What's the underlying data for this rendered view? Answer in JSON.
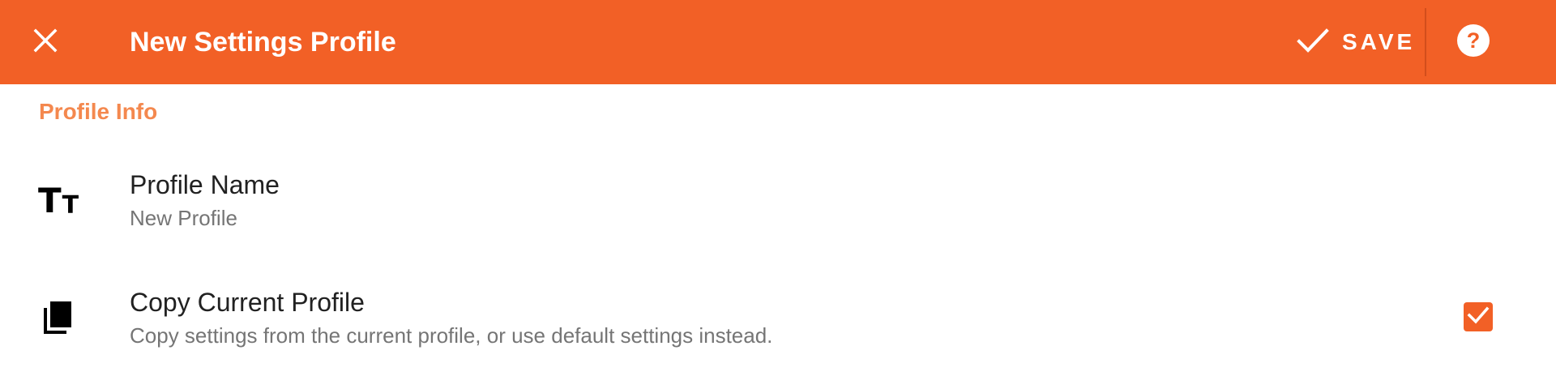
{
  "toolbar": {
    "title": "New Settings Profile",
    "close_icon": "close-icon",
    "save_label": "SAVE",
    "save_icon": "check-icon",
    "help_icon": "help-circle-icon",
    "background_color": "#f26026"
  },
  "section": {
    "header": "Profile Info",
    "header_color": "#f4884e"
  },
  "preferences": [
    {
      "icon": "text-size-icon",
      "title": "Profile Name",
      "summary": "New Profile"
    },
    {
      "icon": "copy-icon",
      "title": "Copy Current Profile",
      "summary": "Copy settings from the current profile, or use default settings instead.",
      "checked": true
    }
  ],
  "colors": {
    "accent": "#f26026",
    "title_text": "#212121",
    "summary_text": "#757575"
  }
}
